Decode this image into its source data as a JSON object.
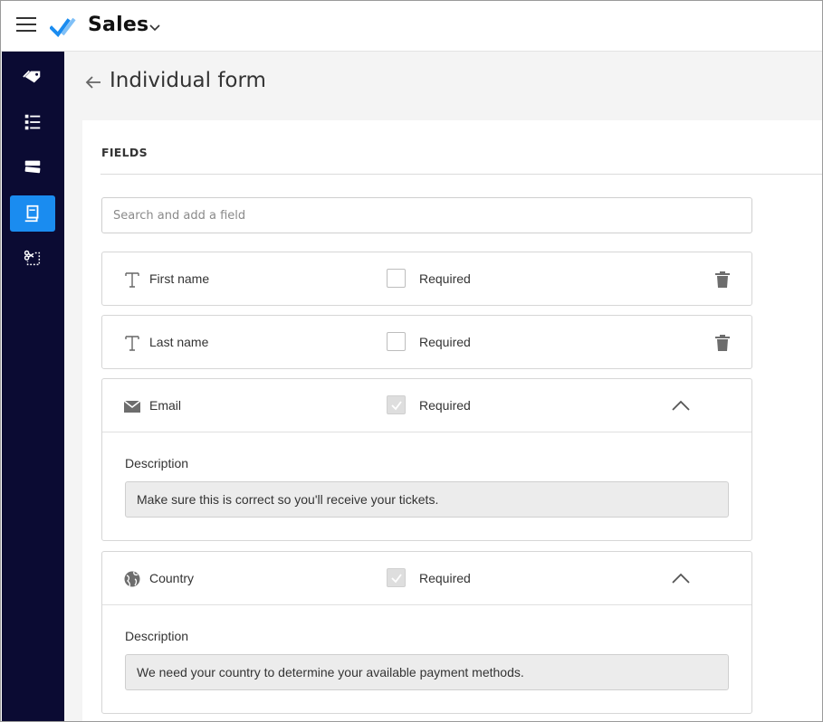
{
  "app": {
    "title": "Sales",
    "brand_color": "#1a8cf0",
    "sidebar_color": "#0b0b33"
  },
  "topbar": {
    "menu_icon": "hamburger-icon",
    "logo_icon": "checkmark-logo-icon",
    "dropdown_icon": "chevron-down-icon"
  },
  "sidebar": {
    "items": [
      {
        "icon": "tickets-icon",
        "active": false
      },
      {
        "icon": "list-icon",
        "active": false
      },
      {
        "icon": "stack-icon",
        "active": false
      },
      {
        "icon": "form-icon",
        "active": true
      },
      {
        "icon": "scissors-selection-icon",
        "active": false
      }
    ]
  },
  "page": {
    "title": "Individual form",
    "back_icon": "arrow-left-icon"
  },
  "fields_section": {
    "label": "FIELDS",
    "search_placeholder": "Search and add a field",
    "fields": [
      {
        "name": "First name",
        "icon": "text-icon",
        "required_label": "Required",
        "required": false,
        "action_icon": "trash-icon"
      },
      {
        "name": "Last name",
        "icon": "text-icon",
        "required_label": "Required",
        "required": false,
        "action_icon": "trash-icon"
      },
      {
        "name": "Email",
        "icon": "envelope-icon",
        "required_label": "Required",
        "required": true,
        "action_icon": "chevron-up-icon",
        "description_label": "Description",
        "description_value": "Make sure this is correct so you'll receive your tickets."
      },
      {
        "name": "Country",
        "icon": "globe-icon",
        "required_label": "Required",
        "required": true,
        "action_icon": "chevron-up-icon",
        "description_label": "Description",
        "description_value": "We need your country to determine your available payment methods."
      }
    ]
  }
}
